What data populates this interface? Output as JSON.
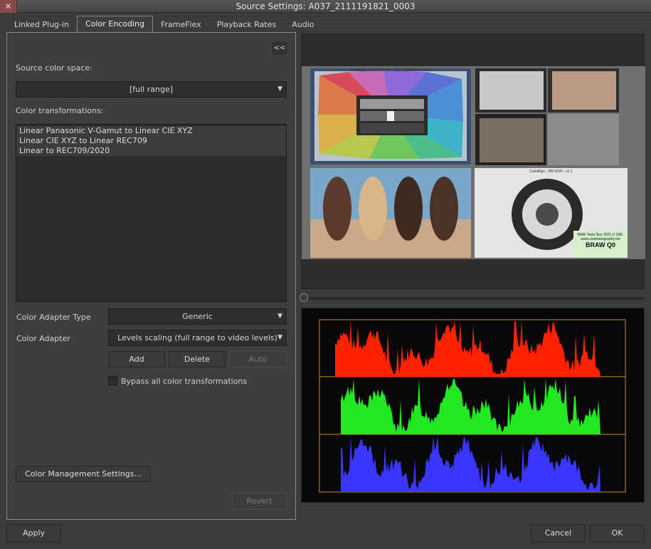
{
  "window": {
    "title": "Source Settings: A037_2111191821_0003",
    "close_glyph": "✕"
  },
  "tabs": [
    {
      "label": "Linked Plug-in"
    },
    {
      "label": "Color Encoding",
      "active": true
    },
    {
      "label": "FrameFlex"
    },
    {
      "label": "Playback Rates"
    },
    {
      "label": "Audio"
    }
  ],
  "panel": {
    "collapse_label": "<<",
    "source_color_space_label": "Source color space:",
    "source_color_space_value": "[full range]",
    "color_transformations_label": "Color transformations:",
    "transformations": [
      "Linear Panasonic V-Gamut to Linear CIE XYZ",
      "Linear CIE XYZ to Linear REC709",
      "Linear to REC709/2020"
    ],
    "color_adapter_type_label": "Color Adapter Type",
    "color_adapter_type_value": "Generic",
    "color_adapter_label": "Color Adapter",
    "color_adapter_value": "Levels scaling (full range to video levels)",
    "add_label": "Add",
    "delete_label": "Delete",
    "auto_label": "Auto",
    "bypass_label": "Bypass all color transformations",
    "bypass_checked": false,
    "color_management_label": "Color Management Settings...",
    "revert_label": "Revert"
  },
  "preview": {
    "chart_text": "CamAlign - ChromaMatch* Geo - 7002829 - v1.1 a1",
    "chart_text_2": "CamAlign - RB-SKIN - v1.1",
    "slate_line1": "RAW Tests Nov 2021 © CML",
    "slate_line2": "www.cinematography.net",
    "slate_line3": "BRAW Q0"
  },
  "footer": {
    "apply_label": "Apply",
    "cancel_label": "Cancel",
    "ok_label": "OK"
  },
  "colors": {
    "red_channel": "#ff2200",
    "green_channel": "#22e822",
    "blue_channel": "#3a35ff",
    "scope_frame": "#d48a28"
  }
}
